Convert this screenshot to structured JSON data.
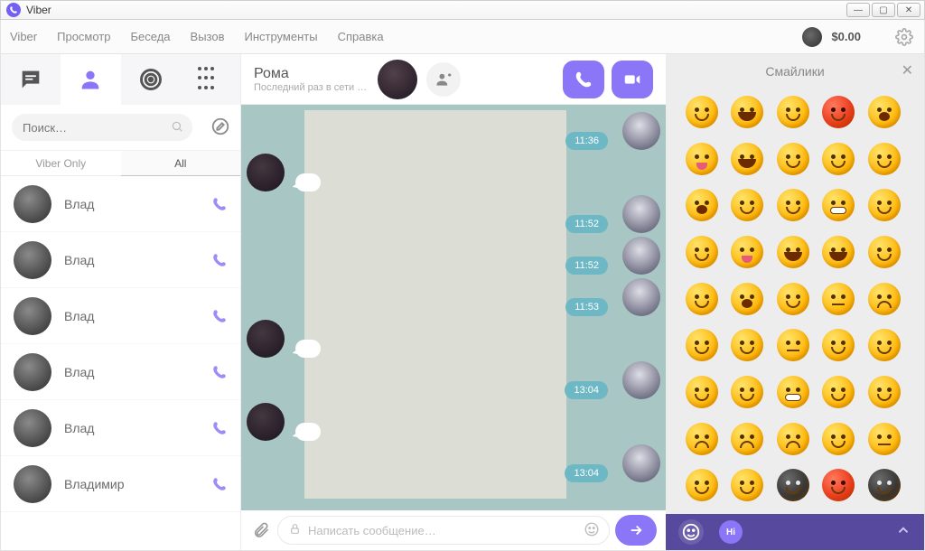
{
  "window": {
    "title": "Viber"
  },
  "menu": {
    "items": [
      "Viber",
      "Просмотр",
      "Беседа",
      "Вызов",
      "Инструменты",
      "Справка"
    ],
    "balance": "$0.00"
  },
  "sidebar": {
    "search_placeholder": "Поиск…",
    "filter": {
      "viber_only": "Viber Only",
      "all": "All"
    },
    "contacts": [
      {
        "name": "Влад"
      },
      {
        "name": "Влад"
      },
      {
        "name": "Влад"
      },
      {
        "name": "Влад"
      },
      {
        "name": "Влад"
      },
      {
        "name": "Владимир"
      }
    ]
  },
  "chat": {
    "title": "Рома",
    "subtitle": "Последний раз в сети …",
    "messages": [
      {
        "side": "right",
        "time": "11:36"
      },
      {
        "side": "left",
        "time": ""
      },
      {
        "side": "right",
        "time": "11:52"
      },
      {
        "side": "right",
        "time": "11:52"
      },
      {
        "side": "right",
        "time": "11:53"
      },
      {
        "side": "left",
        "time": ""
      },
      {
        "side": "right",
        "time": "13:04"
      },
      {
        "side": "left",
        "time": ""
      },
      {
        "side": "right",
        "time": "13:04"
      }
    ],
    "input_placeholder": "Написать сообщение…"
  },
  "emoji_panel": {
    "title": "Смайлики",
    "footer_hi": "Hi"
  }
}
